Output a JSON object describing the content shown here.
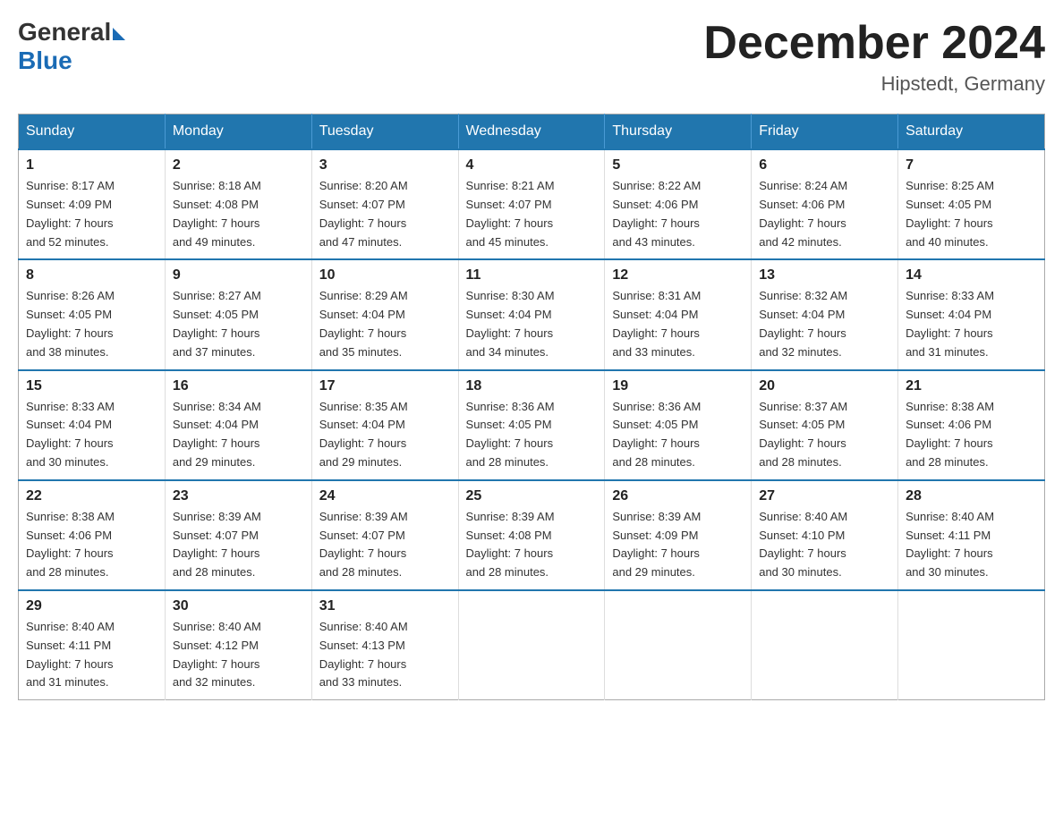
{
  "logo": {
    "text_general": "General",
    "text_blue": "Blue"
  },
  "title": "December 2024",
  "location": "Hipstedt, Germany",
  "header": {
    "days": [
      "Sunday",
      "Monday",
      "Tuesday",
      "Wednesday",
      "Thursday",
      "Friday",
      "Saturday"
    ]
  },
  "weeks": [
    [
      {
        "day": "1",
        "sunrise": "8:17 AM",
        "sunset": "4:09 PM",
        "daylight": "7 hours and 52 minutes."
      },
      {
        "day": "2",
        "sunrise": "8:18 AM",
        "sunset": "4:08 PM",
        "daylight": "7 hours and 49 minutes."
      },
      {
        "day": "3",
        "sunrise": "8:20 AM",
        "sunset": "4:07 PM",
        "daylight": "7 hours and 47 minutes."
      },
      {
        "day": "4",
        "sunrise": "8:21 AM",
        "sunset": "4:07 PM",
        "daylight": "7 hours and 45 minutes."
      },
      {
        "day": "5",
        "sunrise": "8:22 AM",
        "sunset": "4:06 PM",
        "daylight": "7 hours and 43 minutes."
      },
      {
        "day": "6",
        "sunrise": "8:24 AM",
        "sunset": "4:06 PM",
        "daylight": "7 hours and 42 minutes."
      },
      {
        "day": "7",
        "sunrise": "8:25 AM",
        "sunset": "4:05 PM",
        "daylight": "7 hours and 40 minutes."
      }
    ],
    [
      {
        "day": "8",
        "sunrise": "8:26 AM",
        "sunset": "4:05 PM",
        "daylight": "7 hours and 38 minutes."
      },
      {
        "day": "9",
        "sunrise": "8:27 AM",
        "sunset": "4:05 PM",
        "daylight": "7 hours and 37 minutes."
      },
      {
        "day": "10",
        "sunrise": "8:29 AM",
        "sunset": "4:04 PM",
        "daylight": "7 hours and 35 minutes."
      },
      {
        "day": "11",
        "sunrise": "8:30 AM",
        "sunset": "4:04 PM",
        "daylight": "7 hours and 34 minutes."
      },
      {
        "day": "12",
        "sunrise": "8:31 AM",
        "sunset": "4:04 PM",
        "daylight": "7 hours and 33 minutes."
      },
      {
        "day": "13",
        "sunrise": "8:32 AM",
        "sunset": "4:04 PM",
        "daylight": "7 hours and 32 minutes."
      },
      {
        "day": "14",
        "sunrise": "8:33 AM",
        "sunset": "4:04 PM",
        "daylight": "7 hours and 31 minutes."
      }
    ],
    [
      {
        "day": "15",
        "sunrise": "8:33 AM",
        "sunset": "4:04 PM",
        "daylight": "7 hours and 30 minutes."
      },
      {
        "day": "16",
        "sunrise": "8:34 AM",
        "sunset": "4:04 PM",
        "daylight": "7 hours and 29 minutes."
      },
      {
        "day": "17",
        "sunrise": "8:35 AM",
        "sunset": "4:04 PM",
        "daylight": "7 hours and 29 minutes."
      },
      {
        "day": "18",
        "sunrise": "8:36 AM",
        "sunset": "4:05 PM",
        "daylight": "7 hours and 28 minutes."
      },
      {
        "day": "19",
        "sunrise": "8:36 AM",
        "sunset": "4:05 PM",
        "daylight": "7 hours and 28 minutes."
      },
      {
        "day": "20",
        "sunrise": "8:37 AM",
        "sunset": "4:05 PM",
        "daylight": "7 hours and 28 minutes."
      },
      {
        "day": "21",
        "sunrise": "8:38 AM",
        "sunset": "4:06 PM",
        "daylight": "7 hours and 28 minutes."
      }
    ],
    [
      {
        "day": "22",
        "sunrise": "8:38 AM",
        "sunset": "4:06 PM",
        "daylight": "7 hours and 28 minutes."
      },
      {
        "day": "23",
        "sunrise": "8:39 AM",
        "sunset": "4:07 PM",
        "daylight": "7 hours and 28 minutes."
      },
      {
        "day": "24",
        "sunrise": "8:39 AM",
        "sunset": "4:07 PM",
        "daylight": "7 hours and 28 minutes."
      },
      {
        "day": "25",
        "sunrise": "8:39 AM",
        "sunset": "4:08 PM",
        "daylight": "7 hours and 28 minutes."
      },
      {
        "day": "26",
        "sunrise": "8:39 AM",
        "sunset": "4:09 PM",
        "daylight": "7 hours and 29 minutes."
      },
      {
        "day": "27",
        "sunrise": "8:40 AM",
        "sunset": "4:10 PM",
        "daylight": "7 hours and 30 minutes."
      },
      {
        "day": "28",
        "sunrise": "8:40 AM",
        "sunset": "4:11 PM",
        "daylight": "7 hours and 30 minutes."
      }
    ],
    [
      {
        "day": "29",
        "sunrise": "8:40 AM",
        "sunset": "4:11 PM",
        "daylight": "7 hours and 31 minutes."
      },
      {
        "day": "30",
        "sunrise": "8:40 AM",
        "sunset": "4:12 PM",
        "daylight": "7 hours and 32 minutes."
      },
      {
        "day": "31",
        "sunrise": "8:40 AM",
        "sunset": "4:13 PM",
        "daylight": "7 hours and 33 minutes."
      },
      null,
      null,
      null,
      null
    ]
  ],
  "labels": {
    "sunrise": "Sunrise:",
    "sunset": "Sunset:",
    "daylight": "Daylight:"
  }
}
